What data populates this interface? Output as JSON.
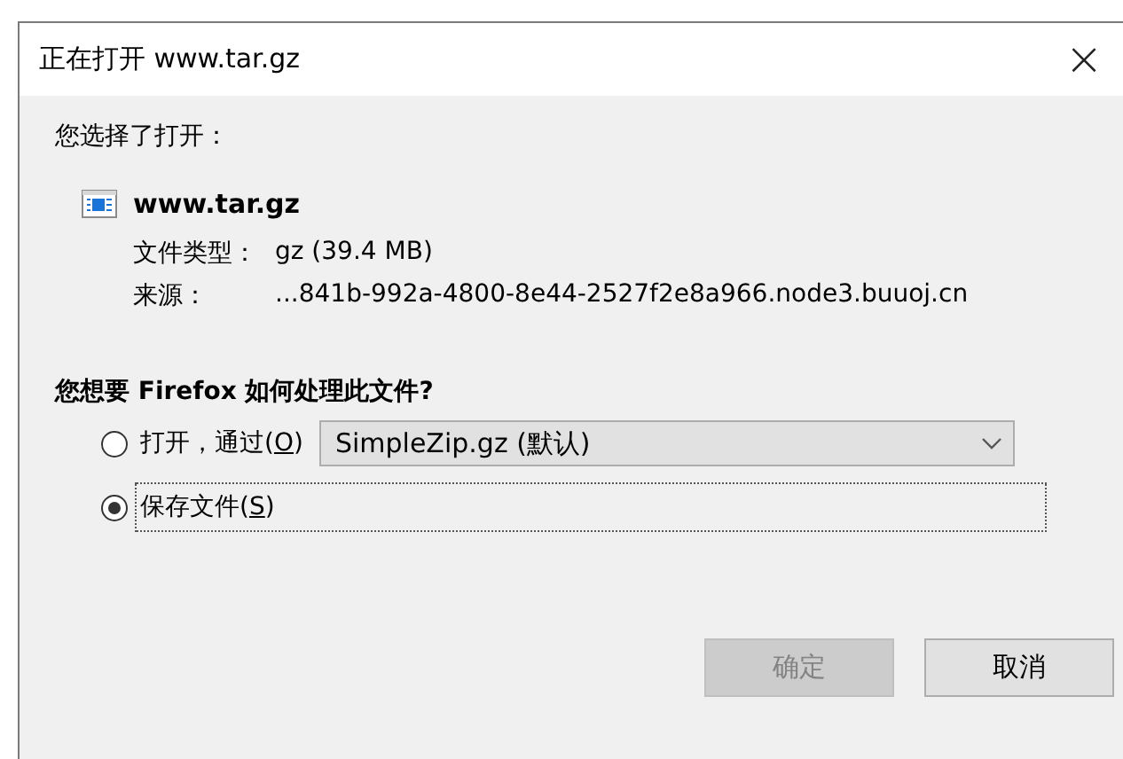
{
  "window": {
    "title": "正在打开 www.tar.gz",
    "close": "×"
  },
  "intro": "您选择了打开：",
  "file": {
    "name": "www.tar.gz"
  },
  "details": [
    {
      "label": "文件类型：",
      "value": "gz (39.4 MB)"
    },
    {
      "label": "来源：",
      "value": "...841b-992a-4800-8e44-2527f2e8a966.node3.buuoj.cn"
    }
  ],
  "question": "您想要 Firefox 如何处理此文件?",
  "options": [
    {
      "kind": "open",
      "label_before": "打开，通过(",
      "access_key": "O",
      "label_after": ")",
      "selected": false,
      "focused": false,
      "dropdown": "SimpleZip.gz (默认)"
    },
    {
      "kind": "save",
      "label_before": "保存文件(",
      "access_key": "S",
      "label_after": ")",
      "selected": true,
      "focused": true
    }
  ],
  "buttons": [
    {
      "label": "确定",
      "disabled": true
    },
    {
      "label": "取消",
      "disabled": false
    }
  ]
}
